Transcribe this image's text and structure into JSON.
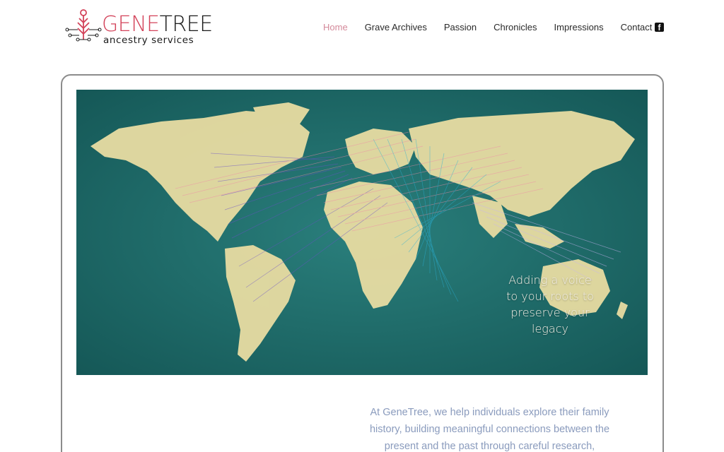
{
  "brand": {
    "word_gene": "GENE",
    "word_tree": "TREE",
    "tagline": "ancestry services",
    "accent_color": "#d3435a"
  },
  "nav": {
    "items": [
      {
        "label": "Home",
        "active": true
      },
      {
        "label": "Grave Archives",
        "active": false
      },
      {
        "label": "Passion",
        "active": false
      },
      {
        "label": "Chronicles",
        "active": false
      },
      {
        "label": "Impressions",
        "active": false
      },
      {
        "label": "Contact",
        "active": false
      }
    ],
    "social_icon": "facebook-icon",
    "active_color": "#d4899a"
  },
  "hero": {
    "caption_lines": [
      "Adding a voice",
      "to your roots to",
      "preserve your",
      "legacy"
    ],
    "background_color": "#1e6f6e"
  },
  "intro": {
    "lines": [
      "At GeneTree, we help individuals explore their family",
      "history, building meaningful connections between the",
      "present and the past through careful research,"
    ],
    "text_color": "#8a9bbd"
  }
}
